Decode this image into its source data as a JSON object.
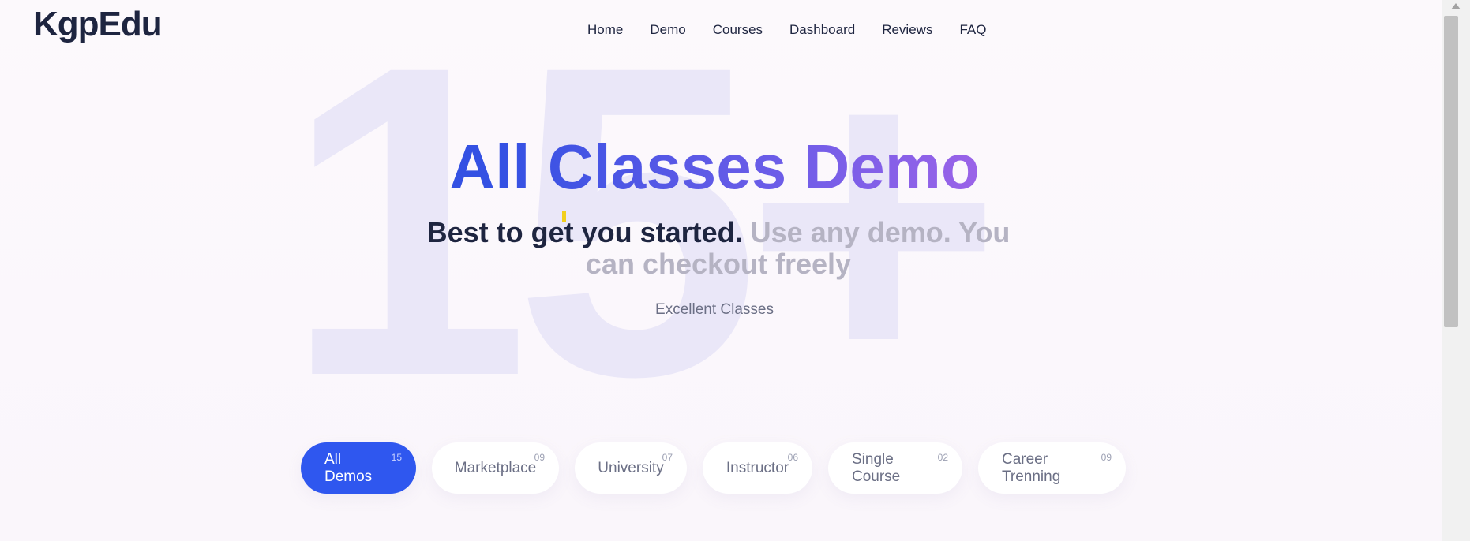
{
  "brand": {
    "logo_text": "KgpEdu"
  },
  "nav": {
    "items": [
      {
        "label": "Home"
      },
      {
        "label": "Demo"
      },
      {
        "label": "Courses"
      },
      {
        "label": "Dashboard"
      },
      {
        "label": "Reviews"
      },
      {
        "label": "FAQ"
      }
    ]
  },
  "hero": {
    "background_number": "15+",
    "title": "All Classes Demo",
    "subtitle_dark": "Best to get you started.",
    "subtitle_muted": "Use any demo. You can checkout freely",
    "tagline": "Excellent Classes"
  },
  "filters": {
    "tabs": [
      {
        "label": "All Demos",
        "count": "15",
        "active": true
      },
      {
        "label": "Marketplace",
        "count": "09",
        "active": false
      },
      {
        "label": "University",
        "count": "07",
        "active": false
      },
      {
        "label": "Instructor",
        "count": "06",
        "active": false
      },
      {
        "label": "Single Course",
        "count": "02",
        "active": false
      },
      {
        "label": "Career Trenning",
        "count": "09",
        "active": false
      }
    ]
  },
  "colors": {
    "primary": "#2f57ef",
    "title_gradient_start": "#3451e3",
    "title_gradient_end": "#b066e8",
    "text_dark": "#1e2540",
    "text_muted": "#b5b3c3",
    "cursor_accent": "#f2cf1c"
  }
}
